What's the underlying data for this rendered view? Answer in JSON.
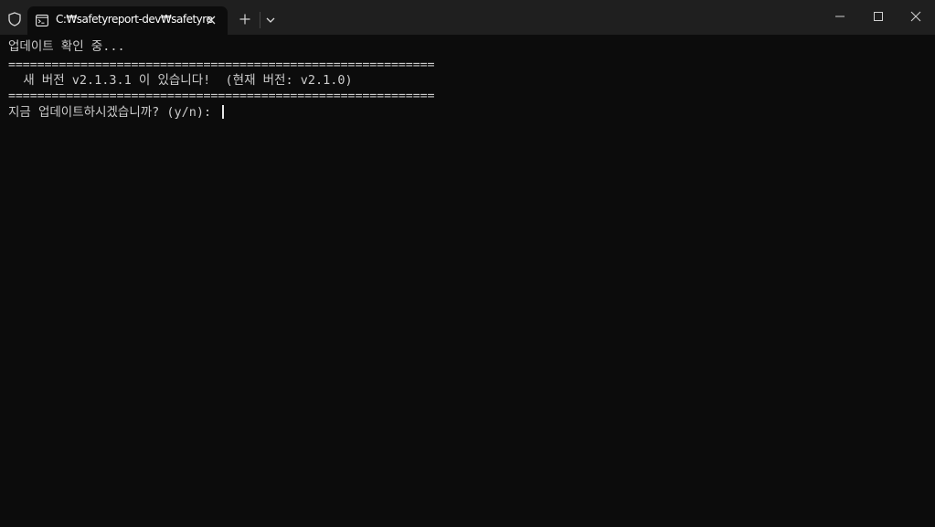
{
  "tab": {
    "title": "C:₩safetyreport-dev₩safetyre",
    "icon": "terminal-icon"
  },
  "window_controls": {
    "minimize_icon": "minimize-icon",
    "maximize_icon": "maximize-icon",
    "close_icon": "close-icon"
  },
  "terminal": {
    "line1": "업데이트 확인 중...",
    "separator_top": "===========================================================",
    "line2": "  새 버전 v2.1.3.1 이 있습니다!  (현재 버전: v2.1.0)",
    "separator_bottom": "===========================================================",
    "prompt": "지금 업데이트하시겠습니까? (y/n): "
  },
  "colors": {
    "background": "#0c0c0c",
    "titlebar": "#1f1f1f",
    "text": "#cccccc"
  }
}
